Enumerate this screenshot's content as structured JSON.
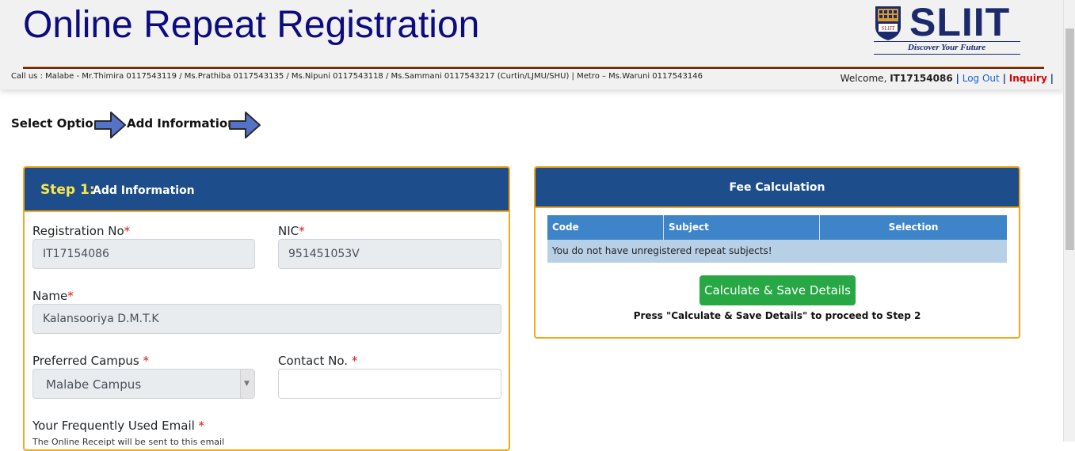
{
  "header": {
    "title": "Online Repeat Registration",
    "logo_text": "SLIIT",
    "logo_crest_text": "SLIIT",
    "tagline": "Discover Your Future",
    "contact": "Call us : Malabe - Mr.Thimira 0117543119 / Ms.Prathiba 0117543135 / Ms.Nipuni 0117543118 / Ms.Sammani 0117543217 (Curtin/LJMU/SHU) | Metro – Ms.Waruni 0117543146",
    "welcome_prefix": "Welcome,",
    "user_id": "IT17154086",
    "logout_label": "Log Out",
    "inquiry_label": "Inquiry",
    "separator": "|"
  },
  "steps": [
    {
      "label": "Select Option"
    },
    {
      "label": "Add Information"
    }
  ],
  "form": {
    "step_num": "Step 1:",
    "step_title": "Add Information",
    "registration_label": "Registration No",
    "registration_value": "IT17154086",
    "nic_label": "NIC",
    "nic_value": "951451053V",
    "name_label": "Name",
    "name_value": "Kalansooriya D.M.T.K",
    "campus_label": "Preferred Campus ",
    "campus_value": "Malabe Campus",
    "contact_label": "Contact No. ",
    "contact_value": "",
    "email_label": "Your Frequently Used Email ",
    "email_note": "The Online Receipt will be sent to this email",
    "required_mark": "*"
  },
  "fee": {
    "title": "Fee Calculation",
    "columns": [
      "Code",
      "Subject",
      "Selection"
    ],
    "empty_message": "You do not have unregistered repeat subjects!",
    "calc_button": "Calculate & Save Details",
    "note": "Press \"Calculate & Save Details\" to proceed to Step 2"
  },
  "colors": {
    "panel_header": "#1e4d8c",
    "panel_border": "#f6a81a",
    "title_blue": "#0c0c7e",
    "button_green": "#28a745",
    "required_red": "#dc1414"
  },
  "icons": [
    "arrow-right-icon",
    "chevron-down-icon",
    "crest-icon"
  ]
}
